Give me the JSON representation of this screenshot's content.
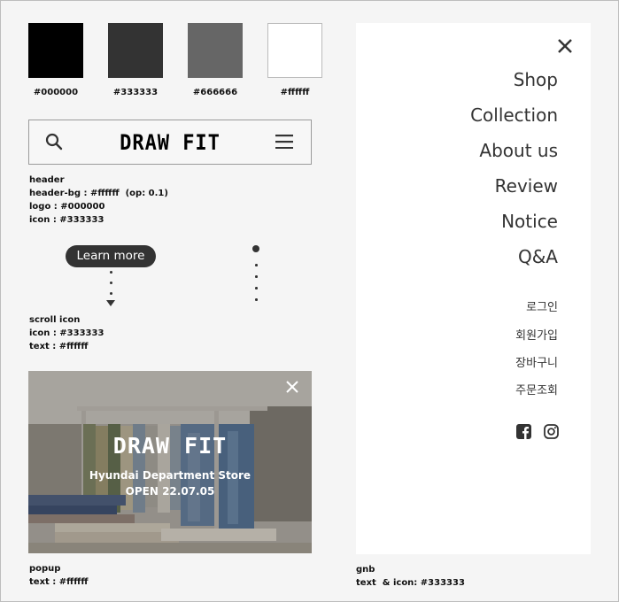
{
  "swatches": [
    {
      "color": "#000000",
      "label": "#000000"
    },
    {
      "color": "#333333",
      "label": "#333333"
    },
    {
      "color": "#666666",
      "label": "#666666"
    },
    {
      "color": "#ffffff",
      "label": "#ffffff"
    }
  ],
  "header": {
    "logo": "DRAW FIT",
    "notes": [
      "header",
      "header-bg : #ffffff  (op: 0.1)",
      "logo : #000000",
      "icon : #333333"
    ]
  },
  "scroll": {
    "button_label": "Learn more",
    "notes": [
      "scroll icon",
      "icon : #333333",
      "text : #ffffff"
    ]
  },
  "popup": {
    "logo": "DRAW FIT",
    "line1": "Hyundai Department Store",
    "line2": "OPEN 22.07.05",
    "notes": [
      "popup",
      "text : #ffffff"
    ]
  },
  "gnb": {
    "main": [
      "Shop",
      "Collection",
      "About us",
      "Review",
      "Notice",
      "Q&A"
    ],
    "sub": [
      "로그인",
      "회원가입",
      "장바구니",
      "주문조회"
    ],
    "social": [
      "facebook-icon",
      "instagram-icon"
    ],
    "notes": [
      "gnb",
      "text  & icon: #333333"
    ]
  },
  "colors": {
    "accent": "#333333",
    "panel": "#ffffff",
    "background": "#f5f5f5"
  }
}
